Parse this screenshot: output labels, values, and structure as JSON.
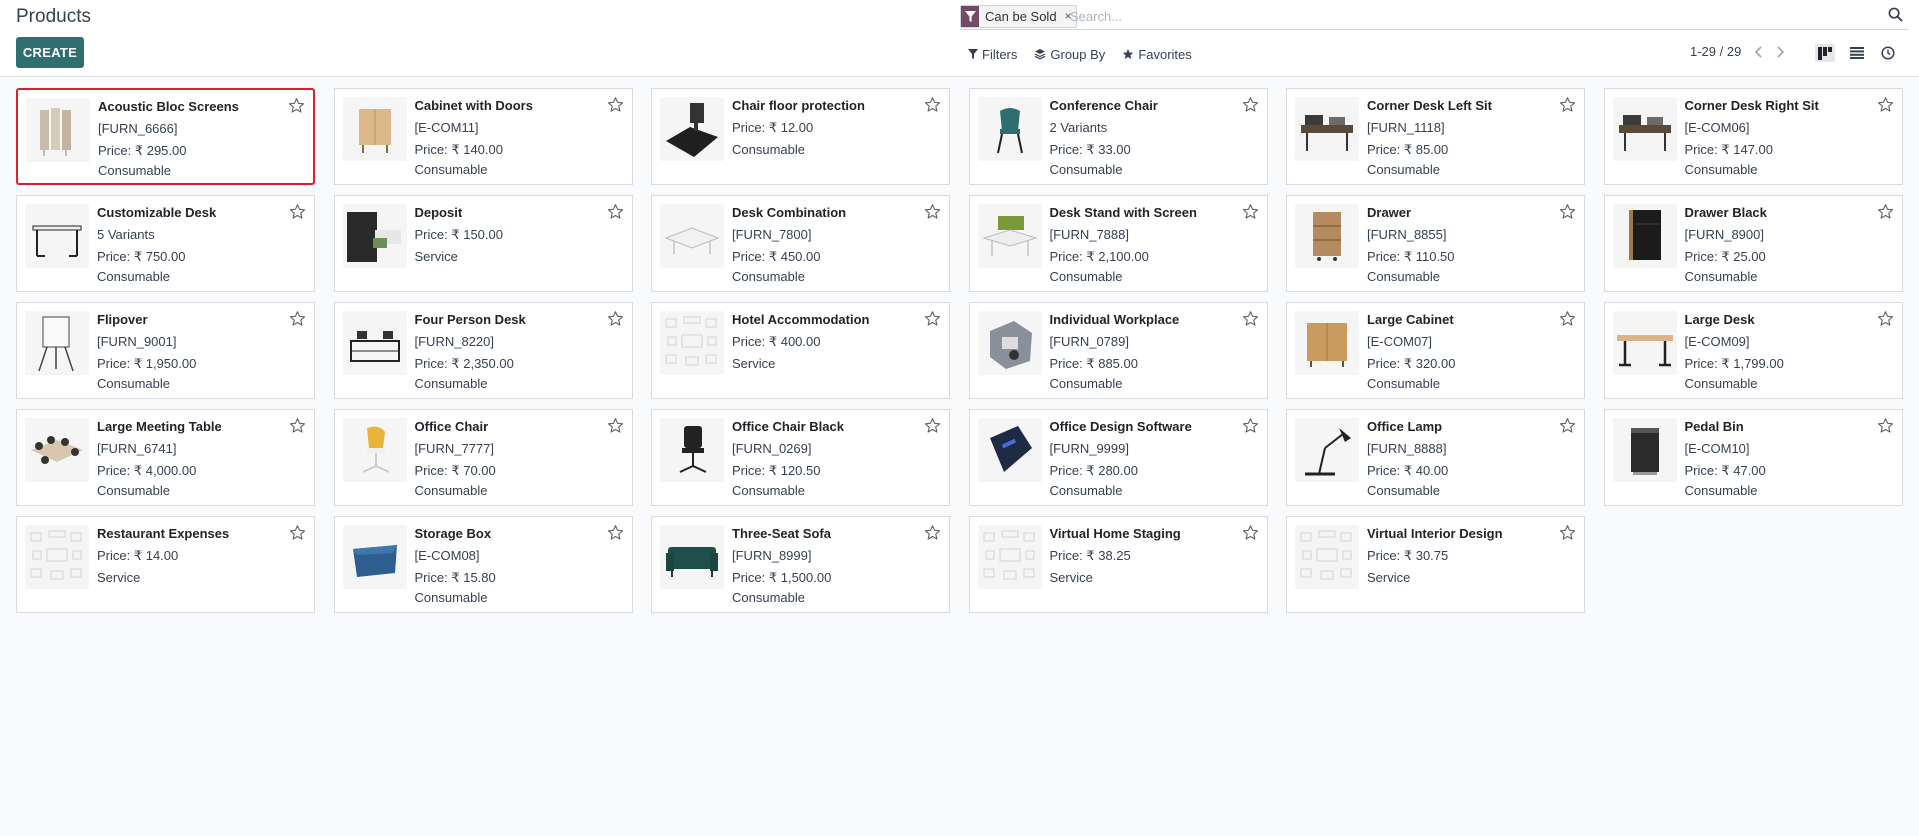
{
  "page_title": "Products",
  "create_label": "CREATE",
  "search": {
    "facet_label": "Can be Sold",
    "facet_remove": "×",
    "placeholder": "Search...",
    "facet_color": "#714b67"
  },
  "search_options": {
    "filters": "Filters",
    "group_by": "Group By",
    "favorites": "Favorites"
  },
  "pager": {
    "value": "1-29 / 29"
  },
  "accent_color": "#2f6f72",
  "products": [
    {
      "name": "Acoustic Bloc Screens",
      "line1": "[FURN_6666]",
      "line2": "Price: ₹ 295.00",
      "line3": "Consumable",
      "img": "screens"
    },
    {
      "name": "Cabinet with Doors",
      "line1": "[E-COM11]",
      "line2": "Price: ₹ 140.00",
      "line3": "Consumable",
      "img": "cabinet"
    },
    {
      "name": "Chair floor protection",
      "line1": "Price: ₹ 12.00",
      "line2": "Consumable",
      "line3": "",
      "img": "mat"
    },
    {
      "name": "Conference Chair",
      "line1": "2 Variants",
      "line2": "Price: ₹ 33.00",
      "line3": "Consumable",
      "img": "chair-teal"
    },
    {
      "name": "Corner Desk Left Sit",
      "line1": "[FURN_1118]",
      "line2": "Price: ₹ 85.00",
      "line3": "Consumable",
      "img": "desk-dark"
    },
    {
      "name": "Corner Desk Right Sit",
      "line1": "[E-COM06]",
      "line2": "Price: ₹ 147.00",
      "line3": "Consumable",
      "img": "desk-dark"
    },
    {
      "name": "Customizable Desk",
      "line1": "5 Variants",
      "line2": "Price: ₹ 750.00",
      "line3": "Consumable",
      "img": "desk-frame"
    },
    {
      "name": "Deposit",
      "line1": "Price: ₹ 150.00",
      "line2": "Service",
      "line3": "",
      "img": "deposit"
    },
    {
      "name": "Desk Combination",
      "line1": "[FURN_7800]",
      "line2": "Price: ₹ 450.00",
      "line3": "Consumable",
      "img": "desk-white"
    },
    {
      "name": "Desk Stand with Screen",
      "line1": "[FURN_7888]",
      "line2": "Price: ₹ 2,100.00",
      "line3": "Consumable",
      "img": "desk-green"
    },
    {
      "name": "Drawer",
      "line1": "[FURN_8855]",
      "line2": "Price: ₹ 110.50",
      "line3": "Consumable",
      "img": "drawer-wood"
    },
    {
      "name": "Drawer Black",
      "line1": "[FURN_8900]",
      "line2": "Price: ₹ 25.00",
      "line3": "Consumable",
      "img": "drawer-black"
    },
    {
      "name": "Flipover",
      "line1": "[FURN_9001]",
      "line2": "Price: ₹ 1,950.00",
      "line3": "Consumable",
      "img": "flipover"
    },
    {
      "name": "Four Person Desk",
      "line1": "[FURN_8220]",
      "line2": "Price: ₹ 2,350.00",
      "line3": "Consumable",
      "img": "four-desk"
    },
    {
      "name": "Hotel Accommodation",
      "line1": "Price: ₹ 400.00",
      "line2": "Service",
      "line3": "",
      "img": "placeholder"
    },
    {
      "name": "Individual Workplace",
      "line1": "[FURN_0789]",
      "line2": "Price: ₹ 885.00",
      "line3": "Consumable",
      "img": "workplace"
    },
    {
      "name": "Large Cabinet",
      "line1": "[E-COM07]",
      "line2": "Price: ₹ 320.00",
      "line3": "Consumable",
      "img": "large-cabinet"
    },
    {
      "name": "Large Desk",
      "line1": "[E-COM09]",
      "line2": "Price: ₹ 1,799.00",
      "line3": "Consumable",
      "img": "large-desk"
    },
    {
      "name": "Large Meeting Table",
      "line1": "[FURN_6741]",
      "line2": "Price: ₹ 4,000.00",
      "line3": "Consumable",
      "img": "meeting"
    },
    {
      "name": "Office Chair",
      "line1": "[FURN_7777]",
      "line2": "Price: ₹ 70.00",
      "line3": "Consumable",
      "img": "chair-yellow"
    },
    {
      "name": "Office Chair Black",
      "line1": "[FURN_0269]",
      "line2": "Price: ₹ 120.50",
      "line3": "Consumable",
      "img": "chair-black"
    },
    {
      "name": "Office Design Software",
      "line1": "[FURN_9999]",
      "line2": "Price: ₹ 280.00",
      "line3": "Consumable",
      "img": "software"
    },
    {
      "name": "Office Lamp",
      "line1": "[FURN_8888]",
      "line2": "Price: ₹ 40.00",
      "line3": "Consumable",
      "img": "lamp"
    },
    {
      "name": "Pedal Bin",
      "line1": "[E-COM10]",
      "line2": "Price: ₹ 47.00",
      "line3": "Consumable",
      "img": "bin"
    },
    {
      "name": "Restaurant Expenses",
      "line1": "Price: ₹ 14.00",
      "line2": "Service",
      "line3": "",
      "img": "placeholder"
    },
    {
      "name": "Storage Box",
      "line1": "[E-COM08]",
      "line2": "Price: ₹ 15.80",
      "line3": "Consumable",
      "img": "box"
    },
    {
      "name": "Three-Seat Sofa",
      "line1": "[FURN_8999]",
      "line2": "Price: ₹ 1,500.00",
      "line3": "Consumable",
      "img": "sofa"
    },
    {
      "name": "Virtual Home Staging",
      "line1": "Price: ₹ 38.25",
      "line2": "Service",
      "line3": "",
      "img": "placeholder"
    },
    {
      "name": "Virtual Interior Design",
      "line1": "Price: ₹ 30.75",
      "line2": "Service",
      "line3": "",
      "img": "placeholder"
    }
  ]
}
